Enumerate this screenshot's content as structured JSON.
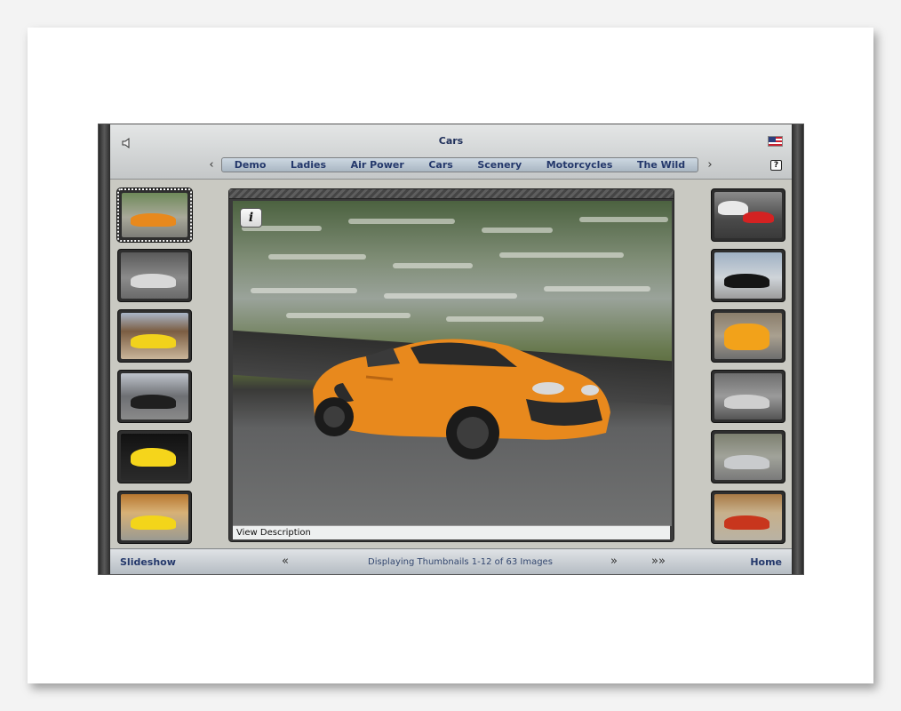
{
  "window": {
    "title": "Cars"
  },
  "header": {
    "sound_icon": "speaker-icon",
    "flag_icon": "us-flag-icon",
    "help_label": "?",
    "prev_arrow": "‹",
    "next_arrow": "›"
  },
  "tabs": [
    {
      "label": "Demo"
    },
    {
      "label": "Ladies"
    },
    {
      "label": "Air Power"
    },
    {
      "label": "Cars"
    },
    {
      "label": "Scenery"
    },
    {
      "label": "Motorcycles"
    },
    {
      "label": "The Wild"
    }
  ],
  "thumbnails_left": [
    {
      "subject": "orange sports car",
      "selected": true
    },
    {
      "subject": "silver sports car",
      "selected": false
    },
    {
      "subject": "yellow lamborghini",
      "selected": false
    },
    {
      "subject": "black sports car",
      "selected": false
    },
    {
      "subject": "yellow lamborghini front",
      "selected": false
    },
    {
      "subject": "yellow corvette",
      "selected": false
    }
  ],
  "thumbnails_right": [
    {
      "subject": "white and red race cars"
    },
    {
      "subject": "black mercedes"
    },
    {
      "subject": "yellow lamborghini front"
    },
    {
      "subject": "silver sports car"
    },
    {
      "subject": "silver mercedes"
    },
    {
      "subject": "red muscle car"
    }
  ],
  "viewer": {
    "info_label": "i",
    "caption": "View Description",
    "subject": "orange Lotus Exige on track"
  },
  "footer": {
    "slideshow": "Slideshow",
    "status": "Displaying Thumbnails 1-12 of 63 Images",
    "prev": "«",
    "next": "»",
    "last": "»»",
    "home": "Home"
  },
  "colors": {
    "accent_text": "#24386b",
    "panel": "#c9c9c2",
    "car_orange": "#e88a1e"
  }
}
